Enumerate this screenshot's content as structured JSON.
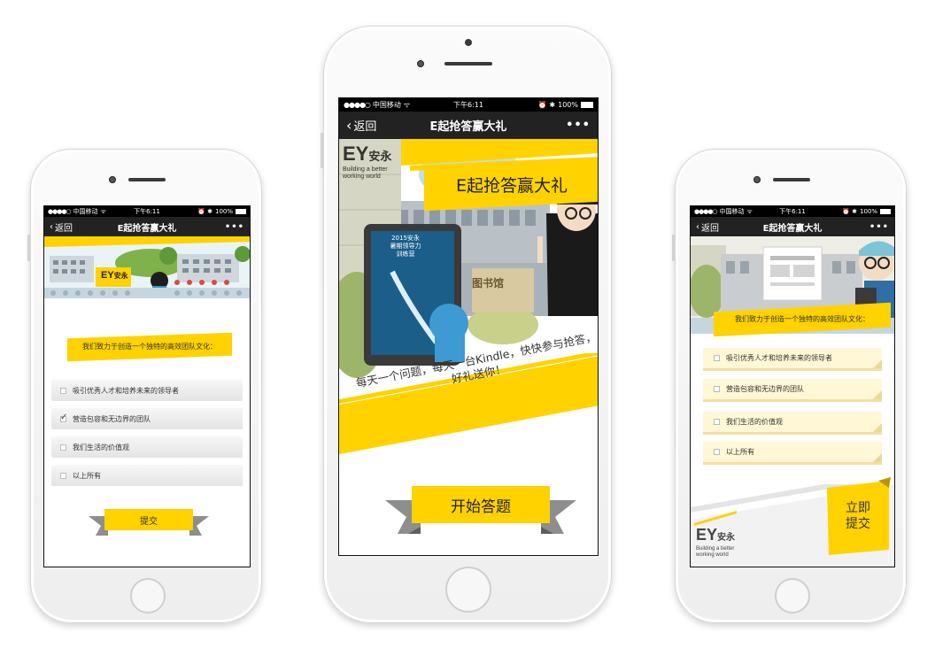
{
  "status_bar": {
    "carrier": "中国移动",
    "time": "下午6:11",
    "battery": "100%"
  },
  "nav": {
    "back_label": "返回",
    "title": "E起抢答赢大礼",
    "more_label": "•••"
  },
  "brand": {
    "logo_text": "EY",
    "logo_cn": "安永",
    "tagline_1": "Building a better",
    "tagline_2": "working world"
  },
  "center_screen": {
    "banner_title": "E起抢答赢大礼",
    "tablet_text_1": "2015安永",
    "tablet_text_2": "暑期领导力",
    "tablet_text_3": "训练营",
    "building_sign": "图书馆",
    "promo_line_1": "每天一个问题，每天一台Kindle，快快参与抢答，",
    "promo_line_2": "好礼送你！",
    "start_button": "开始答题"
  },
  "left_screen": {
    "question": "我们致力于创造一个独特的高效团队文化：",
    "options": [
      {
        "label": "吸引优秀人才和培养未来的领导者",
        "checked": false
      },
      {
        "label": "营造包容和无边界的团队",
        "checked": true
      },
      {
        "label": "我们生活的价值观",
        "checked": false
      },
      {
        "label": "以上所有",
        "checked": false
      }
    ],
    "submit_button": "提交"
  },
  "right_screen": {
    "question": "我们致力于创造一个独特的高效团队文化：",
    "options": [
      {
        "label": "吸引优秀人才和培养未来的领导者"
      },
      {
        "label": "营造包容和无边界的团队"
      },
      {
        "label": "我们生活的价值观"
      },
      {
        "label": "以上所有"
      }
    ],
    "submit_line_1": "立即",
    "submit_line_2": "提交"
  },
  "colors": {
    "brand_yellow": "#ffd200",
    "nav_dark": "#222222",
    "ribbon_gray": "#8e8e8e"
  }
}
